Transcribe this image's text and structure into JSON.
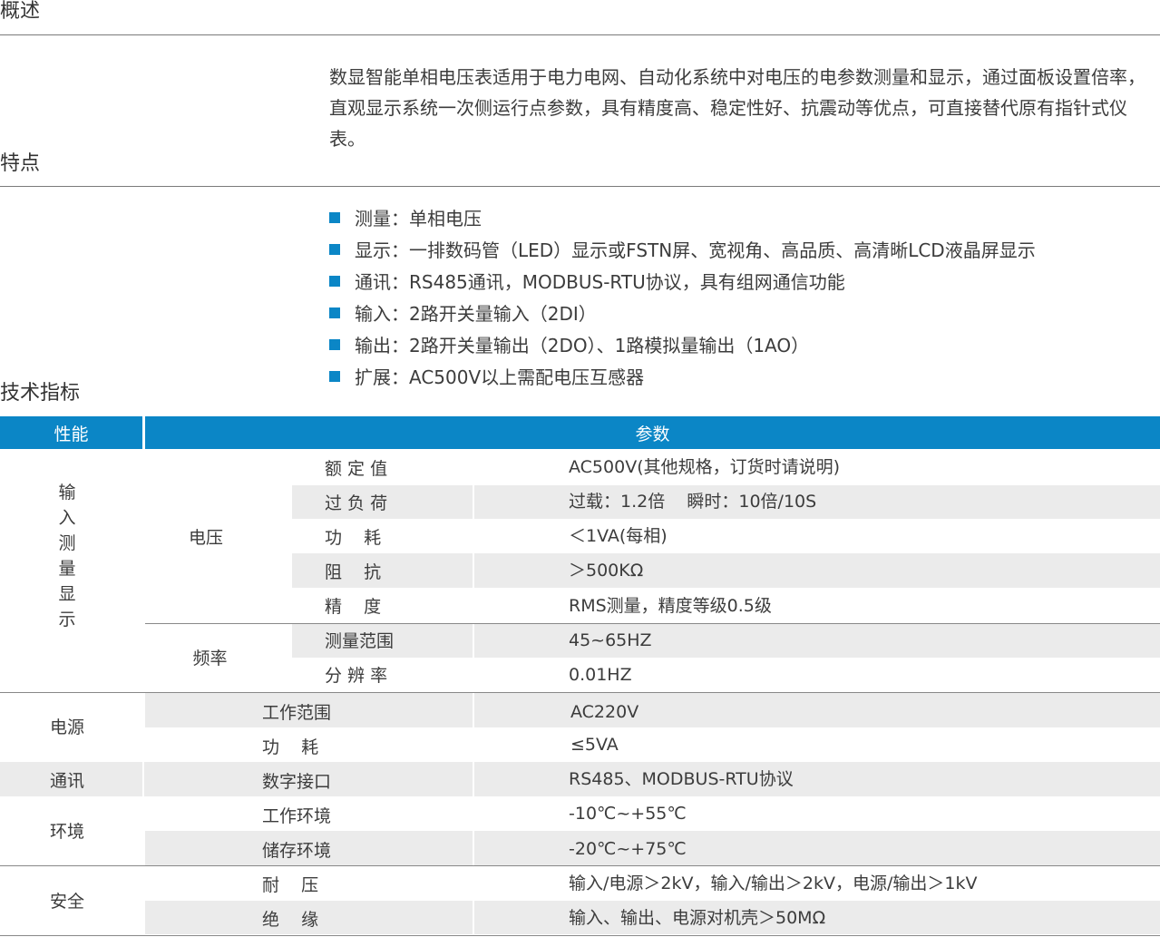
{
  "sections": {
    "overview": "概述",
    "features": "特点",
    "specs": "技术指标"
  },
  "intro": "数显智能单相电压表适用于电力电网、自动化系统中对电压的电参数测量和显示，通过面板设置倍率，直观显示系统一次侧运行点参数，具有精度高、稳定性好、抗震动等优点，可直接替代原有指针式仪表。",
  "features": [
    "测量：单相电压",
    "显示：一排数码管（LED）显示或FSTN屏、宽视角、高品质、高清晰LCD液晶屏显示",
    "通讯：RS485通讯，MODBUS-RTU协议，具有组网通信功能",
    "输入：2路开关量输入（2DI）",
    "输出：2路开关量输出（2DO）、1路模拟量输出（1AO）",
    "扩展：AC500V以上需配电压互感器"
  ],
  "table": {
    "header": {
      "performance": "性能",
      "parameter": "参数"
    },
    "input_group": [
      "输",
      "入",
      "测",
      "量",
      "显",
      "示"
    ],
    "voltage_label": "电压",
    "voltage_rows": [
      {
        "name": "额 定 值",
        "value": "AC500V(其他规格，订货时请说明)"
      },
      {
        "name": "过 负 荷",
        "value": "过载：1.2倍    瞬时：10倍/10S"
      },
      {
        "name": "功    耗",
        "value": "＜1VA(每相)"
      },
      {
        "name": "阻    抗",
        "value": "＞500KΩ"
      },
      {
        "name": "精    度",
        "value": "RMS测量，精度等级0.5级"
      }
    ],
    "frequency_label": "频率",
    "frequency_rows": [
      {
        "name": "测量范围",
        "value": "45~65HZ"
      },
      {
        "name": "分 辨 率",
        "value": "0.01HZ"
      }
    ],
    "power_label": "电源",
    "power_rows": [
      {
        "name": "工作范围",
        "value": "AC220V"
      },
      {
        "name": "功    耗",
        "value": "≤5VA"
      }
    ],
    "comm_label": "通讯",
    "comm_rows": [
      {
        "name": "数字接口",
        "value": "RS485、MODBUS-RTU协议"
      }
    ],
    "env_label": "环境",
    "env_rows": [
      {
        "name": "工作环境",
        "value": "-10℃~+55℃"
      },
      {
        "name": "储存环境",
        "value": "-20℃~+75℃"
      }
    ],
    "safety_label": "安全",
    "safety_rows": [
      {
        "name": "耐    压",
        "value": "输入/电源＞2kV，输入/输出＞2kV，电源/输出＞1kV"
      },
      {
        "name": "绝    缘",
        "value": "输入、输出、电源对机壳＞50MΩ"
      }
    ]
  }
}
